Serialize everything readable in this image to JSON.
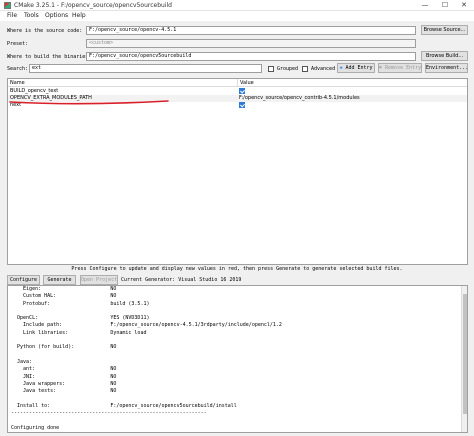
{
  "window": {
    "title": "CMake 3.25.1 - F:/opencv_source/opencv5ourcebuild",
    "minimize": "—",
    "maximize": "☐",
    "close": "✕"
  },
  "menu": [
    "File",
    "Tools",
    "Options",
    "Help"
  ],
  "source": {
    "label": "Where is the source code:",
    "value": "F:/opencv_source/opencv-4.5.1",
    "browse": "Browse Source..."
  },
  "preset": {
    "label": "Preset:",
    "value": "<custom>"
  },
  "build": {
    "label": "Where to build the binaries:",
    "value": "F:/opencv_source/opencv5ourcebuild",
    "browse": "Browse Build..."
  },
  "search": {
    "label": "Search:",
    "value": "ext",
    "grouped": "Grouped",
    "advanced": "Advanced",
    "add_entry": "Add Entry",
    "remove_entry": "Remove Entry",
    "environment": "Environment..."
  },
  "table": {
    "col_name": "Name",
    "col_value": "Value",
    "rows": [
      {
        "name": "BUILD_opencv_text",
        "value": "",
        "checked": true
      },
      {
        "name": "OPENCV_EXTRA_MODULES_PATH",
        "value": "F:/opencv_source/opencv_contrib-4.5.1/modules",
        "checked": false
      },
      {
        "name": "next",
        "value": "",
        "checked": true
      }
    ]
  },
  "status": "Press Configure to update and display new values in red, then press Generate to generate selected build files.",
  "actions": {
    "configure": "Configure",
    "generate": "Generate",
    "open_project": "Open Project",
    "current_generator": "Current Generator: Visual Studio 16 2019"
  },
  "log": [
    "    Eigen:                       NO",
    "    Custom HAL:                  NO",
    "    Protobuf:                    build (3.5.1)",
    "",
    "  OpenCL:                        YES (NVD3D11)",
    "    Include path:                F:/opencv_source/opencv-4.5.1/3rdparty/include/opencl/1.2",
    "    Link libraries:              Dynamic load",
    "",
    "  Python (for build):            NO",
    "",
    "  Java:",
    "    ant:                         NO",
    "    JNI:                         NO",
    "    Java wrappers:               NO",
    "    Java tests:                  NO",
    "",
    "  Install to:                    F:/opencv_source/opencv5ourcebuild/install",
    "-----------------------------------------------------------------",
    "",
    "Configuring done"
  ],
  "colors": {
    "annotation": "#d8202a",
    "check_blue": "#2f7bd6"
  }
}
